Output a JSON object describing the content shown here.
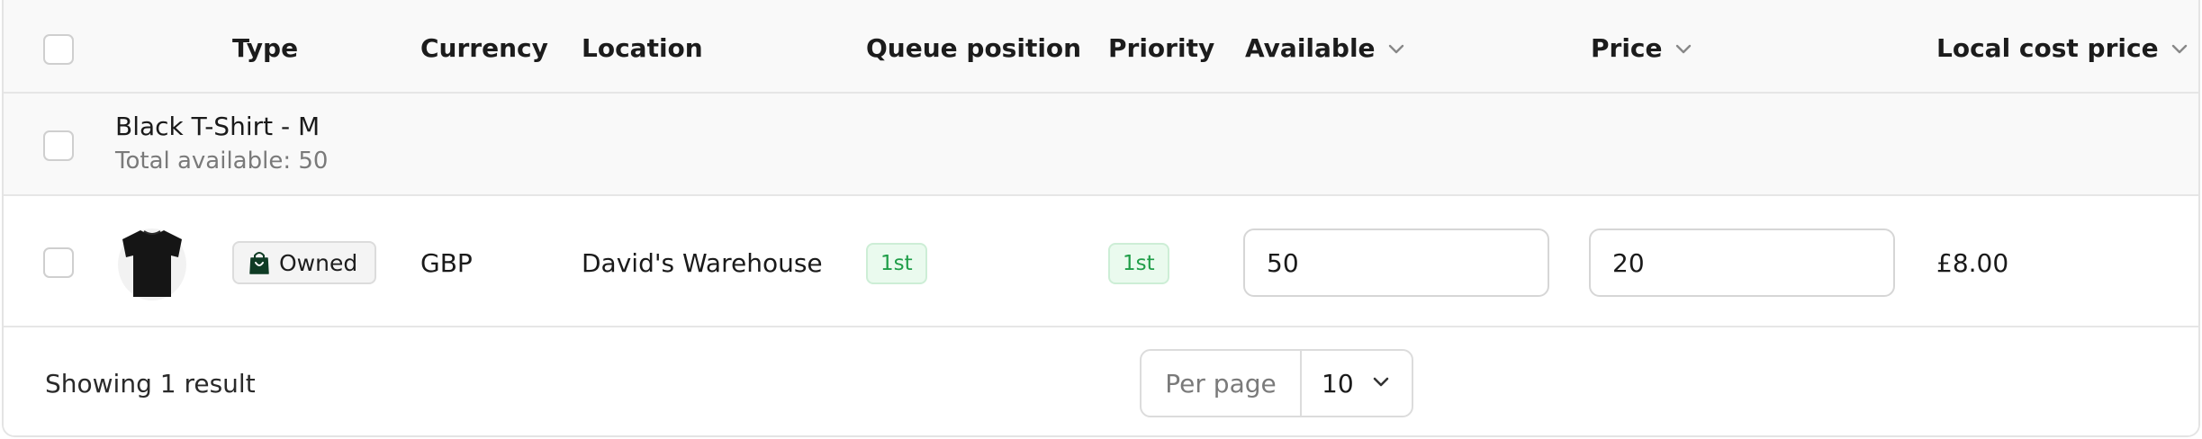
{
  "table": {
    "headers": {
      "type": "Type",
      "currency": "Currency",
      "location": "Location",
      "queue_position": "Queue position",
      "priority": "Priority",
      "available": "Available",
      "price": "Price",
      "local_cost_price": "Local cost price"
    },
    "sortable_icon": "chevron-down-icon",
    "group": {
      "title": "Black T-Shirt - M",
      "subtitle": "Total available: 50"
    },
    "rows": [
      {
        "image_icon": "black-tshirt-image",
        "type": "Owned",
        "type_icon": "shopping-bag-icon",
        "currency": "GBP",
        "location": "David's Warehouse",
        "queue_position": "1st",
        "priority": "1st",
        "available": "50",
        "price": "20",
        "local_cost_price": "£8.00"
      }
    ]
  },
  "footer": {
    "showing": "Showing 1 result",
    "per_page_label": "Per page",
    "per_page_value": "10"
  },
  "colors": {
    "header_bg": "#f9f9f9",
    "border": "#e6e6e6",
    "pill_bg": "#eafaee",
    "pill_text": "#1f9d48",
    "badge_bg": "#f4f4f4",
    "icon_dark": "#0f3b24"
  }
}
